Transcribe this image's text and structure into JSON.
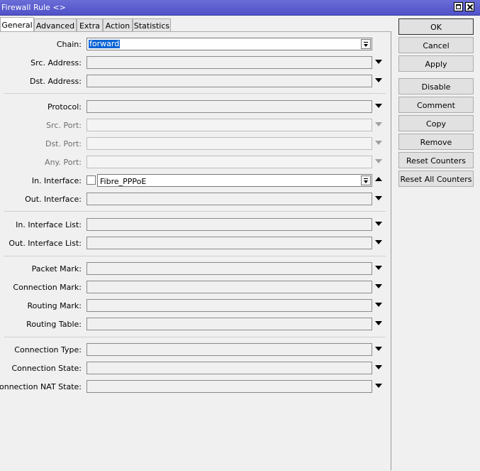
{
  "window": {
    "title": "Firewall Rule <>"
  },
  "tabs": [
    "General",
    "Advanced",
    "Extra",
    "Action",
    "Statistics"
  ],
  "fields": {
    "chain": {
      "label": "Chain:",
      "value": "forward"
    },
    "src_address": {
      "label": "Src. Address:"
    },
    "dst_address": {
      "label": "Dst. Address:"
    },
    "protocol": {
      "label": "Protocol:"
    },
    "src_port": {
      "label": "Src. Port:"
    },
    "dst_port": {
      "label": "Dst. Port:"
    },
    "any_port": {
      "label": "Any. Port:"
    },
    "in_interface": {
      "label": "In. Interface:",
      "value": "Fibre_PPPoE"
    },
    "out_interface": {
      "label": "Out. Interface:"
    },
    "in_interface_list": {
      "label": "In. Interface List:"
    },
    "out_interface_list": {
      "label": "Out. Interface List:"
    },
    "packet_mark": {
      "label": "Packet Mark:"
    },
    "connection_mark": {
      "label": "Connection Mark:"
    },
    "routing_mark": {
      "label": "Routing Mark:"
    },
    "routing_table": {
      "label": "Routing Table:"
    },
    "connection_type": {
      "label": "Connection Type:"
    },
    "connection_state": {
      "label": "Connection State:"
    },
    "connection_nat_state": {
      "label": "Connection NAT State:"
    }
  },
  "buttons": [
    "OK",
    "Cancel",
    "Apply",
    "Disable",
    "Comment",
    "Copy",
    "Remove",
    "Reset Counters",
    "Reset All Counters"
  ]
}
